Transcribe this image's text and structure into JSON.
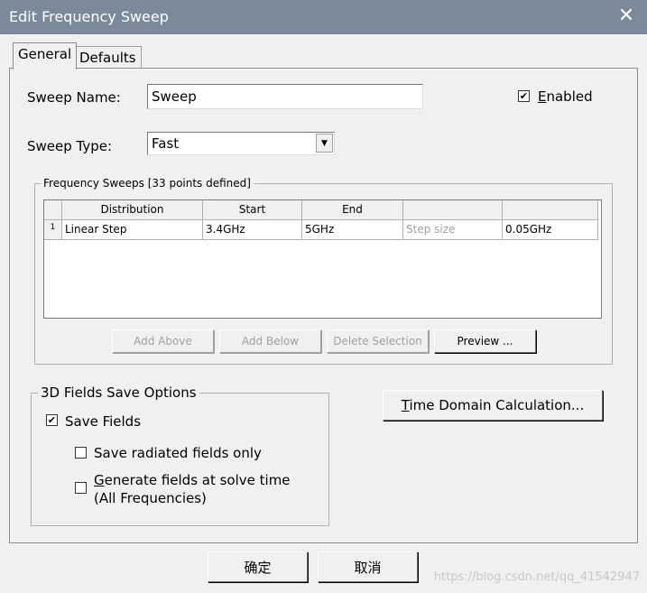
{
  "window": {
    "title": "Edit Frequency Sweep",
    "close_glyph": "✕"
  },
  "tabs": [
    {
      "label": "General",
      "active": true
    },
    {
      "label": "Defaults",
      "active": false
    }
  ],
  "general": {
    "sweep_name_label": "Sweep Name:",
    "sweep_name_value": "Sweep",
    "enabled_label_prefix": "E",
    "enabled_label_rest": "nabled",
    "enabled_checked": true,
    "sweep_type_label": "Sweep Type:",
    "sweep_type_value": "Fast"
  },
  "frequency_sweeps": {
    "group_title": "Frequency Sweeps [33 points defined]",
    "columns": [
      "Distribution",
      "Start",
      "End",
      "",
      ""
    ],
    "rows": [
      {
        "index": "1",
        "cells": [
          "Linear Step",
          "3.4GHz",
          "5GHz",
          "Step size",
          "0.05GHz"
        ]
      }
    ],
    "buttons": {
      "add_above": "Add Above",
      "add_below": "Add Below",
      "delete_selection": "Delete Selection",
      "preview": "Preview ..."
    }
  },
  "fields_save": {
    "group_title": "3D Fields Save Options",
    "save_fields_label": "Save Fields",
    "save_fields_checked": true,
    "save_radiated_label": "Save radiated fields only",
    "save_radiated_checked": false,
    "generate_fields_prefix": "G",
    "generate_fields_rest": "enerate fields at solve time",
    "generate_fields_line2": "(All Frequencies)",
    "generate_fields_checked": false
  },
  "time_domain": {
    "label_prefix": "T",
    "label_rest": "ime Domain Calculation..."
  },
  "footer": {
    "ok_label": "确定",
    "cancel_label": "取消",
    "watermark": "https://blog.csdn.net/qq_41542947"
  },
  "icons": {
    "checkmark": "✔",
    "dropdown_arrow": "▼"
  },
  "colors": {
    "titlebar": "#7a8a9a",
    "dialog_bg": "#f0f0f0",
    "disabled_text": "#a0a0a0"
  }
}
